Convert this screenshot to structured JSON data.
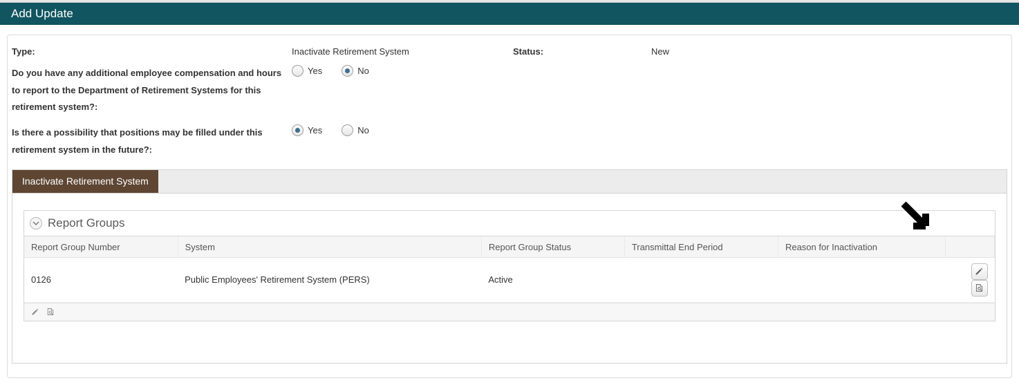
{
  "header": {
    "title": "Add Update"
  },
  "form": {
    "type_label": "Type:",
    "type_value": "Inactivate Retirement System",
    "status_label": "Status:",
    "status_value": "New",
    "q1": "Do you have any additional employee compensation and hours to report to the Department of Retirement Systems for this retirement system?:",
    "q2": "Is there a possibility that positions may be filled under this retirement system in the future?:",
    "yes": "Yes",
    "no": "No",
    "q1_selected": "No",
    "q2_selected": "Yes"
  },
  "tab": {
    "label": "Inactivate Retirement System"
  },
  "grid": {
    "title": "Report Groups",
    "headers": {
      "number": "Report Group Number",
      "system": "System",
      "status": "Report Group Status",
      "trans": "Transmittal End Period",
      "reason": "Reason for Inactivation"
    },
    "row": {
      "number": "0126",
      "system": "Public Employees' Retirement System (PERS)",
      "status": "Active",
      "trans": "",
      "reason": ""
    }
  }
}
